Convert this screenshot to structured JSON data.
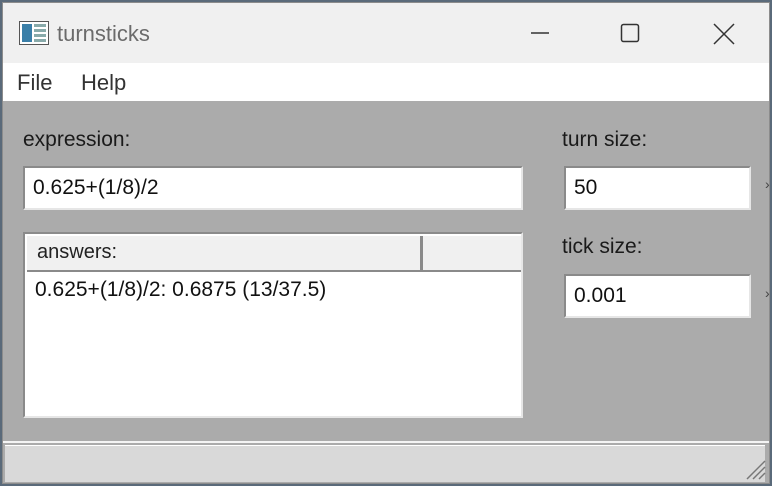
{
  "window": {
    "title": "turnsticks",
    "icon": "app-window-icon",
    "controls": [
      "minimize-icon",
      "maximize-icon",
      "close-icon"
    ]
  },
  "menu": {
    "items": [
      {
        "label": "File"
      },
      {
        "label": "Help"
      }
    ]
  },
  "form": {
    "expression_label": "expression:",
    "expression_value": "0.625+(1/8)/2",
    "turn_size_label": "turn size:",
    "turn_size_value": "50",
    "tick_size_label": "tick size:",
    "tick_size_value": "0.001"
  },
  "answers": {
    "header": "answers:",
    "rows": [
      {
        "text": "0.625+(1/8)/2: 0.6875 (13/37.5)"
      }
    ]
  },
  "colors": {
    "panel_background": "#ababab",
    "titlebar_background": "#f0f0f0",
    "menubar_background": "#ffffff"
  }
}
